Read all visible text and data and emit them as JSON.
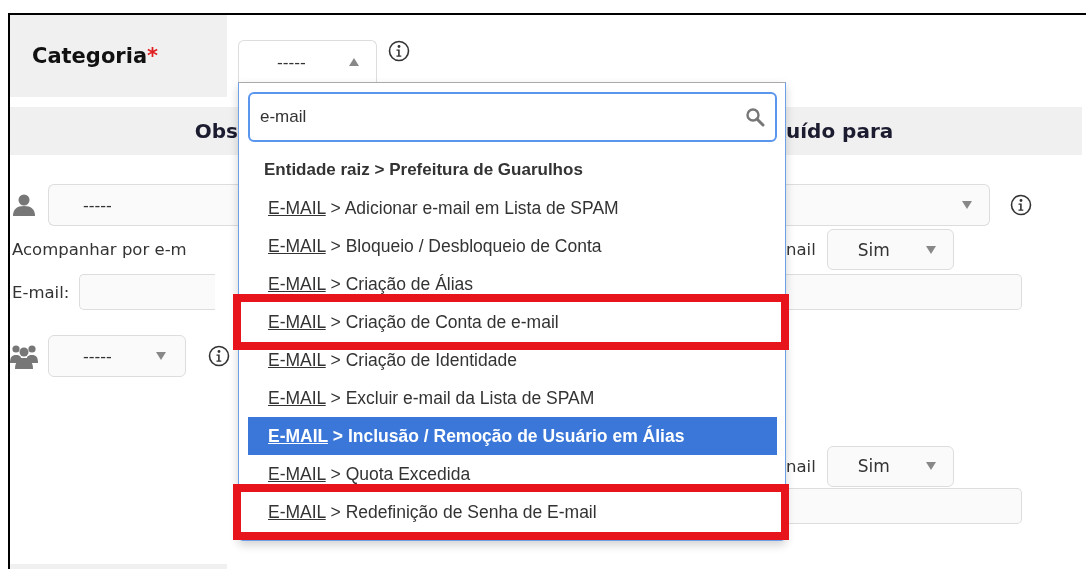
{
  "category": {
    "label": "Categoria",
    "required_mark": "*",
    "value": "-----",
    "expanded": true
  },
  "section_header": {
    "left": "Obs",
    "right": "uído para"
  },
  "requester": {
    "value": "-----"
  },
  "follow_label": "Acompanhar por e-m",
  "email_label": "E-mail:",
  "group_select": {
    "value": "-----"
  },
  "right_rows": [
    {
      "label": "nail",
      "value": "Sim"
    },
    {
      "label": "nail",
      "value": "Sim"
    }
  ],
  "dropdown": {
    "search_value": "e-mail",
    "group": "Entidade raiz > Prefeitura de Guarulhos",
    "options": [
      {
        "match": "E-MAIL",
        "rest": "> Adicionar e-mail em Lista de SPAM",
        "selected": false,
        "highlighted": false
      },
      {
        "match": "E-MAIL",
        "rest": "> Bloqueio / Desbloqueio de Conta",
        "selected": false,
        "highlighted": false
      },
      {
        "match": "E-MAIL",
        "rest": "> Criação de Álias",
        "selected": false,
        "highlighted": false
      },
      {
        "match": "E-MAIL",
        "rest": "> Criação de Conta de e-mail",
        "selected": false,
        "highlighted": true
      },
      {
        "match": "E-MAIL",
        "rest": "> Criação de Identidade",
        "selected": false,
        "highlighted": false
      },
      {
        "match": "E-MAIL",
        "rest": "> Excluir e-mail da Lista de SPAM",
        "selected": false,
        "highlighted": false
      },
      {
        "match": "E-MAIL",
        "rest": "> Inclusão / Remoção de Usuário em Álias",
        "selected": true,
        "highlighted": false
      },
      {
        "match": "E-MAIL",
        "rest": "> Quota Excedida",
        "selected": false,
        "highlighted": false
      },
      {
        "match": "E-MAIL",
        "rest": "> Redefinição de Senha de E-mail",
        "selected": false,
        "highlighted": true
      }
    ]
  }
}
